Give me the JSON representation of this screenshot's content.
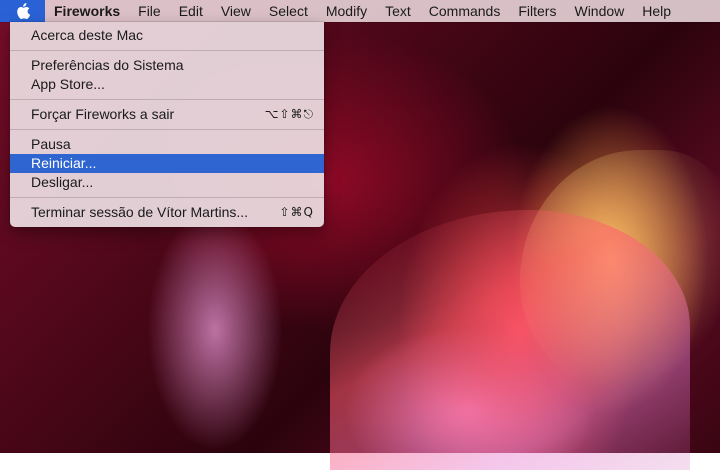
{
  "menubar": {
    "apple_icon": "apple-logo-icon",
    "items": [
      "Fireworks",
      "File",
      "Edit",
      "View",
      "Select",
      "Modify",
      "Text",
      "Commands",
      "Filters",
      "Window",
      "Help"
    ]
  },
  "apple_menu": {
    "about": "Acerca deste Mac",
    "system_prefs": "Preferências do Sistema",
    "app_store": "App Store...",
    "force_quit": "Forçar Fireworks a sair",
    "force_quit_shortcut": "⌥⇧⌘⎋",
    "sleep": "Pausa",
    "restart": "Reiniciar...",
    "shutdown": "Desligar...",
    "logout": "Terminar sessão de Vítor Martins...",
    "logout_shortcut": "⇧⌘Q"
  },
  "colors": {
    "selection": "#2f65d1",
    "menubar_bg": "#ecdade"
  }
}
